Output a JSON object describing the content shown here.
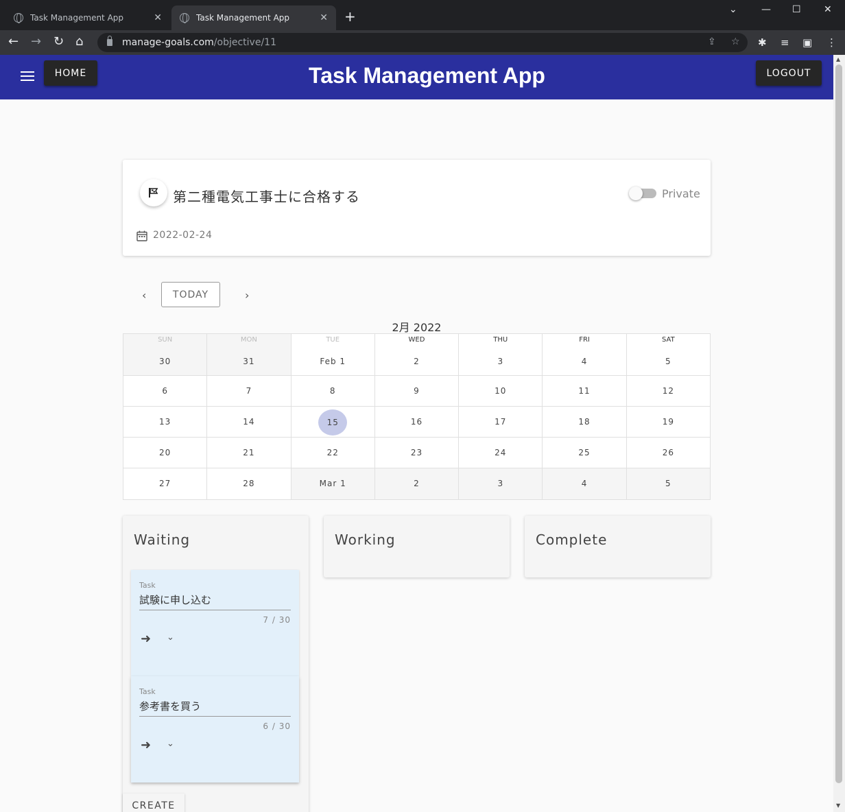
{
  "browser": {
    "tabs": [
      {
        "title": "Task Management App",
        "close": "✕"
      },
      {
        "title": "Task Management App",
        "close": "✕"
      }
    ],
    "new_tab": "+",
    "window_controls": {
      "dropdown": "⌄",
      "minimize": "—",
      "maximize": "☐",
      "close": "✕"
    },
    "url_host": "manage-goals.com",
    "url_path": "/objective/11"
  },
  "header": {
    "home_label": "HOME",
    "title": "Task Management App",
    "logout_label": "LOGOUT",
    "bg_color": "#2a2f9e"
  },
  "objective": {
    "title": "第二種電気工事士に合格する",
    "private_label": "Private",
    "private_on": false,
    "date": "2022-02-24"
  },
  "calendar": {
    "today_label": "TODAY",
    "prev": "‹",
    "next": "›",
    "month_label": "2月 2022",
    "weekdays": [
      "SUN",
      "MON",
      "TUE",
      "WED",
      "THU",
      "FRI",
      "SAT"
    ],
    "weeks": [
      [
        "30",
        "31",
        "Feb 1",
        "2",
        "3",
        "4",
        "5"
      ],
      [
        "6",
        "7",
        "8",
        "9",
        "10",
        "11",
        "12"
      ],
      [
        "13",
        "14",
        "15",
        "16",
        "17",
        "18",
        "19"
      ],
      [
        "20",
        "21",
        "22",
        "23",
        "24",
        "25",
        "26"
      ],
      [
        "27",
        "28",
        "Mar 1",
        "2",
        "3",
        "4",
        "5"
      ]
    ],
    "selected_day": "15"
  },
  "board": {
    "columns": [
      {
        "title": "Waiting",
        "tasks": [
          {
            "label": "Task",
            "name": "試験に申し込む",
            "count": "7 / 30",
            "move_icon": "➜",
            "expand_icon": "⌄"
          },
          {
            "label": "Task",
            "name": "参考書を買う",
            "count": "6 / 30",
            "move_icon": "➜",
            "expand_icon": "⌄"
          }
        ],
        "create_label": "CREATE"
      },
      {
        "title": "Working",
        "tasks": []
      },
      {
        "title": "Complete",
        "tasks": []
      }
    ]
  }
}
